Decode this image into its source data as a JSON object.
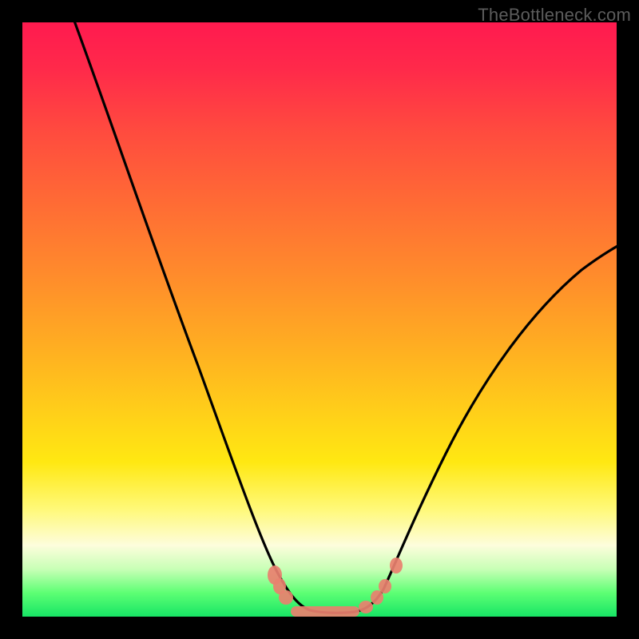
{
  "watermark": "TheBottleneck.com",
  "chart_data": {
    "type": "line",
    "title": "",
    "xlabel": "",
    "ylabel": "",
    "xlim": [
      0,
      100
    ],
    "ylim": [
      0,
      100
    ],
    "series": [
      {
        "name": "bottleneck-curve",
        "x": [
          10,
          15,
          20,
          25,
          30,
          35,
          38,
          40,
          42,
          44,
          46,
          48,
          50,
          52,
          54,
          56,
          58,
          60,
          65,
          70,
          75,
          80,
          85,
          90,
          95,
          100
        ],
        "y": [
          100,
          88,
          76,
          64,
          52,
          38,
          26,
          18,
          10,
          4,
          1,
          0,
          0,
          0,
          0,
          1,
          4,
          8,
          16,
          24,
          32,
          40,
          47,
          53,
          59,
          64
        ]
      }
    ],
    "markers": {
      "name": "highlight-points",
      "x": [
        42,
        43,
        44,
        46,
        48,
        50,
        52,
        54,
        55,
        56,
        58,
        59
      ],
      "y": [
        10,
        7,
        4,
        1,
        0,
        0,
        0,
        0,
        0.5,
        1,
        4,
        6
      ]
    },
    "background_gradient": {
      "top": "#ff1a4f",
      "bottom": "#17e565",
      "meaning": "red=high bottleneck, green=low bottleneck"
    }
  }
}
